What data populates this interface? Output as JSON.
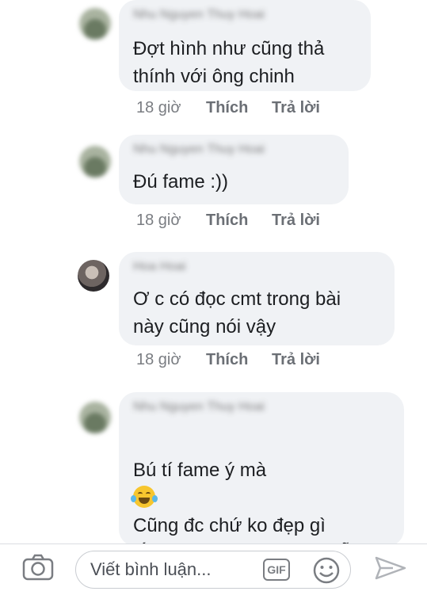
{
  "comments": [
    {
      "author": "Nhu Nguyen Thuy Hoai",
      "text": "Đợt hình như cũng thả\nthính với ông chinh",
      "time": "18 giờ",
      "like": "Thích",
      "reply": "Trả lời"
    },
    {
      "author": "Nhu Nguyen Thuy Hoai",
      "text": "Đú fame :))",
      "time": "18 giờ",
      "like": "Thích",
      "reply": "Trả lời"
    },
    {
      "author": "Hoa Hoai",
      "text": "Ơ c có đọc cmt trong bài\nnày cũng nói vậy",
      "time": "18 giờ",
      "like": "Thích",
      "reply": "Trả lời"
    },
    {
      "author": "Nhu Nguyen Thuy Hoai",
      "text_line1": "Bú tí fame ý mà",
      "emoji": "laughing-tears-emoji",
      "text_rest": "Cũng đc chứ ko đẹp gì\nlắm ,nhưng trông cũng dễ\nnhìn"
    }
  ],
  "composer": {
    "placeholder": "Viết bình luận...",
    "gif_label": "GIF",
    "icons": [
      "camera-icon",
      "gif-icon",
      "smiley-icon",
      "send-icon"
    ]
  },
  "colors": {
    "bubble": "#f0f2f5",
    "meta": "#7a7d82"
  }
}
